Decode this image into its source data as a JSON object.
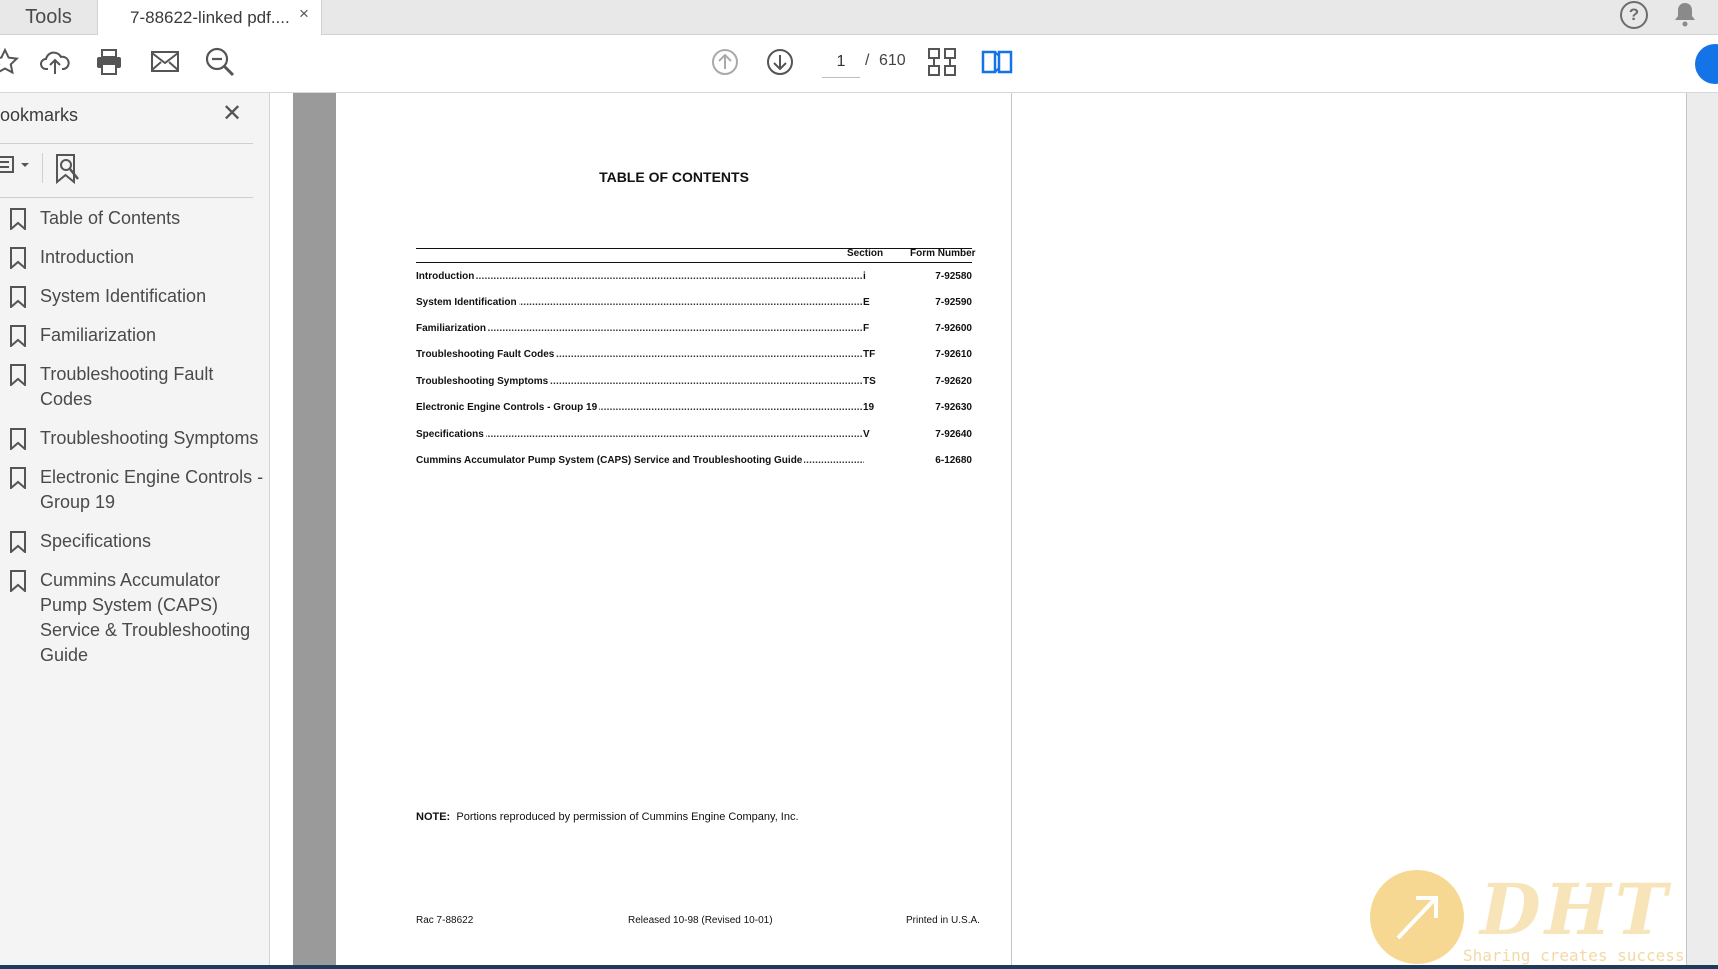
{
  "tabs": {
    "tools_label": "Tools",
    "doc_label": "7-88622-linked pdf....",
    "close_glyph": "×"
  },
  "toolbar": {
    "page_current": "1",
    "page_separator": "/",
    "page_total": "610",
    "icons": [
      "star-icon",
      "cloud-upload-icon",
      "print-icon",
      "mail-icon",
      "zoom-out-icon",
      "page-up-icon",
      "page-down-icon",
      "fit-page-icon",
      "two-page-view-icon"
    ]
  },
  "sidebar": {
    "title": "ookmarks",
    "close_glyph": "✕",
    "bookmarks": [
      {
        "label": "Table of Contents"
      },
      {
        "label": "Introduction"
      },
      {
        "label": "System Identification"
      },
      {
        "label": "Familiarization"
      },
      {
        "label": "Troubleshooting Fault Codes"
      },
      {
        "label": "Troubleshooting Symptoms"
      },
      {
        "label": "Electronic Engine Controls - Group 19"
      },
      {
        "label": "Specifications"
      },
      {
        "label": "Cummins Accumulator Pump System (CAPS) Service & Troubleshooting Guide"
      }
    ]
  },
  "document": {
    "title": "TABLE OF CONTENTS",
    "col_section": "Section",
    "col_form": "Form Number",
    "rows": [
      {
        "name": "Introduction",
        "section": "i",
        "form": "7-92580"
      },
      {
        "name": "System Identification",
        "section": "E",
        "form": "7-92590"
      },
      {
        "name": "Familiarization",
        "section": "F",
        "form": "7-92600"
      },
      {
        "name": "Troubleshooting Fault Codes",
        "section": "TF",
        "form": "7-92610"
      },
      {
        "name": "Troubleshooting Symptoms",
        "section": "TS",
        "form": "7-92620"
      },
      {
        "name": "Electronic Engine Controls - Group 19",
        "section": "19",
        "form": "7-92630"
      },
      {
        "name": "Specifications",
        "section": "V",
        "form": "7-92640"
      },
      {
        "name": "Cummins Accumulator Pump System (CAPS) Service and Troubleshooting Guide",
        "section": "",
        "form": "6-12680"
      }
    ],
    "note_label": "NOTE:",
    "note_text": "Portions reproduced by permission of Cummins Engine Company, Inc.",
    "footer_left": "Rac 7-88622",
    "footer_mid": "Released 10-98 (Revised 10-01)",
    "footer_right": "Printed in U.S.A."
  },
  "watermark": {
    "logo": "DHT",
    "tagline": "Sharing creates success"
  }
}
